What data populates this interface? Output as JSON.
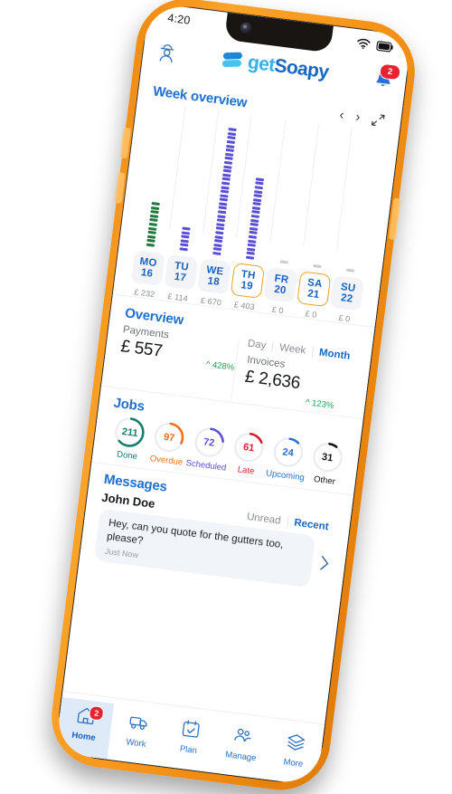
{
  "status_bar": {
    "time": "4:20",
    "wifi_icon": "wifi-icon",
    "battery_icon": "battery-icon"
  },
  "app_header": {
    "profile_icon": "worker-profile-icon",
    "logo_part1": "get",
    "logo_part2": "Soapy",
    "bell_icon": "notification-bell-icon",
    "bell_badge": "2"
  },
  "week_overview": {
    "title": "Week overview",
    "prev_icon": "chevron-left-icon",
    "next_icon": "chevron-right-icon",
    "expand_icon": "expand-icon"
  },
  "chart_data": {
    "type": "bar",
    "title": "Week overview",
    "categories": [
      "MO 16",
      "TU 17",
      "WE 18",
      "TH 19",
      "FR 20",
      "SA 21",
      "SU 22"
    ],
    "day_names": [
      "MO",
      "TU",
      "WE",
      "TH",
      "FR",
      "SA",
      "SU"
    ],
    "day_numbers": [
      "16",
      "17",
      "18",
      "19",
      "20",
      "21",
      "22"
    ],
    "values": [
      232,
      114,
      670,
      403,
      0,
      0,
      0
    ],
    "value_labels": [
      "£ 232",
      "£ 114",
      "£ 670",
      "£ 403",
      "£ 0",
      "£ 0",
      "£ 0"
    ],
    "bar_colors": [
      "#1f7a3f",
      "#5b4fd6",
      "#5b4fd6",
      "#5b4fd6",
      "#c9ccd2",
      "#c9ccd2",
      "#c9ccd2"
    ],
    "segments": [
      11,
      6,
      31,
      20,
      1,
      1,
      1
    ],
    "selected_days": [
      "TH 19",
      "SA 21"
    ],
    "ylabel": "",
    "xlabel": "",
    "grid": true,
    "legend": "none"
  },
  "overview": {
    "title": "Overview",
    "payments_label": "Payments",
    "payments_value": "£ 557",
    "payments_change": "^ 428%",
    "invoices_label": "Invoices",
    "invoices_value": "£ 2,636",
    "invoices_change": "^ 123%",
    "range_tabs": [
      {
        "label": "Day",
        "active": false
      },
      {
        "label": "Week",
        "active": false
      },
      {
        "label": "Month",
        "active": true
      }
    ]
  },
  "jobs": {
    "title": "Jobs",
    "items": [
      {
        "label": "Done",
        "value": "211",
        "color": "#13806e",
        "pct": 62
      },
      {
        "label": "Overdue",
        "value": "97",
        "color": "#f2701d",
        "pct": 30
      },
      {
        "label": "Scheduled",
        "value": "72",
        "color": "#5b4fd6",
        "pct": 22
      },
      {
        "label": "Late",
        "value": "61",
        "color": "#d32029",
        "pct": 17
      },
      {
        "label": "Upcoming",
        "value": "24",
        "color": "#2a6fd4",
        "pct": 11
      },
      {
        "label": "Other",
        "value": "31",
        "color": "#141414",
        "pct": 9
      }
    ]
  },
  "messages": {
    "title": "Messages",
    "sender": "John Doe",
    "filters": [
      {
        "label": "Unread",
        "active": false
      },
      {
        "label": "Recent",
        "active": true
      }
    ],
    "preview": "Hey, can you quote for the gutters too, please?",
    "time": "Just Now",
    "open_icon": "chevron-right-icon"
  },
  "tabbar": {
    "items": [
      {
        "label": "Home",
        "icon": "home-icon",
        "active": true,
        "badge": "2"
      },
      {
        "label": "Work",
        "icon": "truck-icon",
        "active": false,
        "badge": ""
      },
      {
        "label": "Plan",
        "icon": "calendar-icon",
        "active": false,
        "badge": ""
      },
      {
        "label": "Manage",
        "icon": "people-icon",
        "active": false,
        "badge": ""
      },
      {
        "label": "More",
        "icon": "layers-icon",
        "active": false,
        "badge": ""
      }
    ]
  },
  "theme": {
    "brand_blue": "#1668c4",
    "logo_cyan": "#34b3ea",
    "case_orange": "#f79418",
    "accent_gold": "#f0a320",
    "positive_green": "#17a04a",
    "bar_purple": "#5b4fd6",
    "bar_green": "#1f7a3f"
  }
}
